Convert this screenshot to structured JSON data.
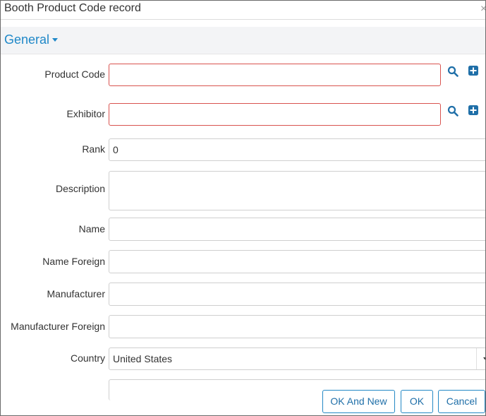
{
  "dialog": {
    "title": "Booth Product Code record",
    "close_glyph": "×"
  },
  "section": {
    "title": "General"
  },
  "fields": {
    "product_code": {
      "label": "Product Code",
      "value": ""
    },
    "exhibitor": {
      "label": "Exhibitor",
      "value": ""
    },
    "rank": {
      "label": "Rank",
      "value": "0"
    },
    "description": {
      "label": "Description",
      "value": ""
    },
    "name": {
      "label": "Name",
      "value": ""
    },
    "name_foreign": {
      "label": "Name Foreign",
      "value": ""
    },
    "manufacturer": {
      "label": "Manufacturer",
      "value": ""
    },
    "manufacturer_foreign": {
      "label": "Manufacturer Foreign",
      "value": ""
    },
    "country": {
      "label": "Country",
      "value": "United States"
    }
  },
  "buttons": {
    "ok_and_new": "OK And New",
    "ok": "OK",
    "cancel": "Cancel"
  },
  "icons": {
    "search": "search-icon",
    "add": "add-square-icon"
  },
  "colors": {
    "accent": "#1f88c8",
    "required_border": "#d9534f",
    "button_border": "#2489c5"
  }
}
